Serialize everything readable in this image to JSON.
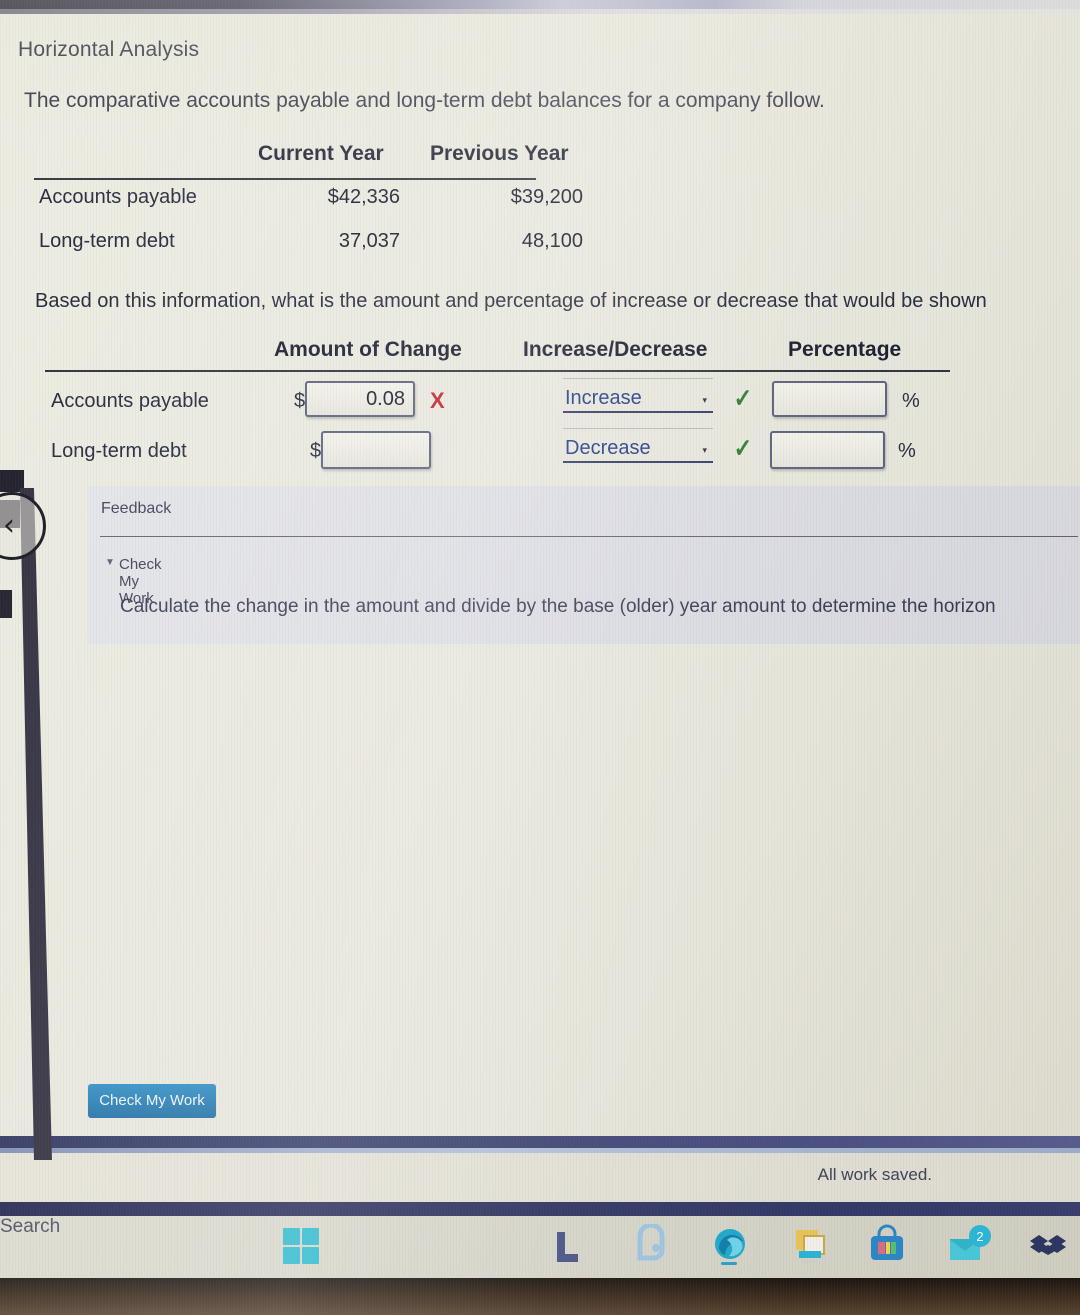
{
  "page": {
    "title": "Horizontal Analysis",
    "intro": "The comparative accounts payable and long-term debt balances for a company follow.",
    "question": "Based on this information, what is the amount and percentage of increase or decrease that would be shown"
  },
  "balances_table": {
    "headers": [
      "Current Year",
      "Previous Year"
    ],
    "rows": [
      {
        "label": "Accounts payable",
        "current_year": "$42,336",
        "previous_year": "$39,200"
      },
      {
        "label": "Long-term debt",
        "current_year": "37,037",
        "previous_year": "48,100"
      }
    ]
  },
  "answer_table": {
    "headers": [
      "Amount of Change",
      "Increase/Decrease",
      "Percentage"
    ],
    "currency_symbol": "$",
    "percent_symbol": "%",
    "rows": [
      {
        "label": "Accounts payable",
        "amount_value": "0.08",
        "amount_mark": "X",
        "direction_value": "Increase",
        "direction_mark": "✓",
        "percentage_value": ""
      },
      {
        "label": "Long-term debt",
        "amount_value": "",
        "amount_mark": "",
        "direction_value": "Decrease",
        "direction_mark": "✓",
        "percentage_value": ""
      }
    ],
    "direction_options": [
      "Increase",
      "Decrease"
    ],
    "caret": "▾"
  },
  "feedback": {
    "title": "Feedback",
    "toggle_label": "Check My Work",
    "toggle_icon": "▼",
    "hint": "Calculate the change in the amount and divide by the base (older) year amount to determine the horizon"
  },
  "footer": {
    "check_button": "Check My Work",
    "save_status": "All work saved."
  },
  "nav": {
    "back_icon": "‹"
  },
  "taskbar": {
    "search_label": "Search",
    "mail_badge": "2",
    "icons": [
      "windows-start-icon",
      "search-icon",
      "file-explorer-icon",
      "teams-icon",
      "edge-icon",
      "folder-icon",
      "microsoft-store-icon",
      "mail-icon",
      "dropbox-icon"
    ]
  },
  "colors": {
    "accent_blue": "#2d8ec4",
    "error_red": "#c0202a",
    "correct_green": "#2c7a2c",
    "link_blue": "#1e3a86"
  }
}
